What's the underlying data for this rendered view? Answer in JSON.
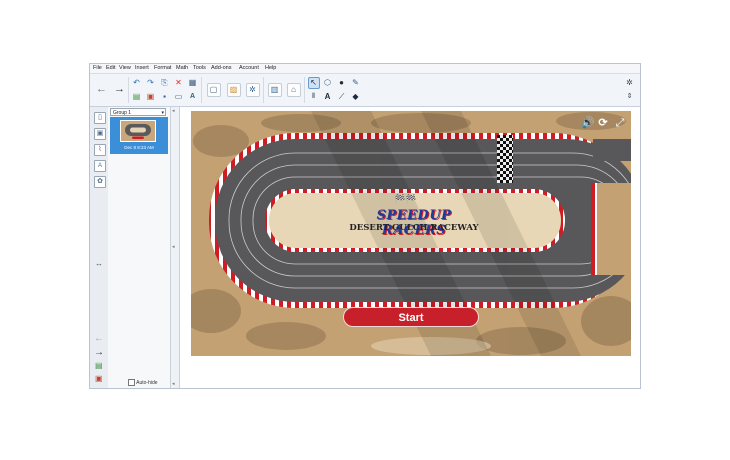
{
  "menu": [
    "File",
    "Edit",
    "View",
    "Insert",
    "Format",
    "Math",
    "Tools",
    "Add-ons",
    "Account",
    "Help"
  ],
  "toolbar": {
    "icons": [
      "back-arrow-icon",
      "forward-arrow-icon",
      "undo-icon",
      "redo-icon",
      "screenshot-icon",
      "delete-icon",
      "table-icon",
      "open-icon",
      "print-icon",
      "save-icon",
      "fullscreen-icon",
      "text-format-icon",
      "display-icon",
      "capture-icon",
      "gallery-icon",
      "addon-icon",
      "page-icon",
      "home-icon",
      "select-icon",
      "pen-icon",
      "fill-icon",
      "eraser-icon",
      "text-icon",
      "line-icon",
      "highlighter-icon"
    ],
    "settings_icon": "gear-icon",
    "expand_icon": "updown-arrow-icon"
  },
  "sorter": {
    "group": "Group 1",
    "page_label": "Dec 8 8:23 AM",
    "auto_hide": "Auto-hide"
  },
  "game": {
    "brand_line1": "SPEEDUP RACERS",
    "brand_line2": "DESERT GULCH RACEWAY",
    "start_label": "Start",
    "icons": [
      "volume-icon",
      "restart-icon",
      "fullscreen-icon"
    ]
  },
  "colors": {
    "accent_blue": "#3b8fd8",
    "start_red": "#c8202b",
    "track_gray": "#58585a",
    "sand": "#c3a173"
  }
}
